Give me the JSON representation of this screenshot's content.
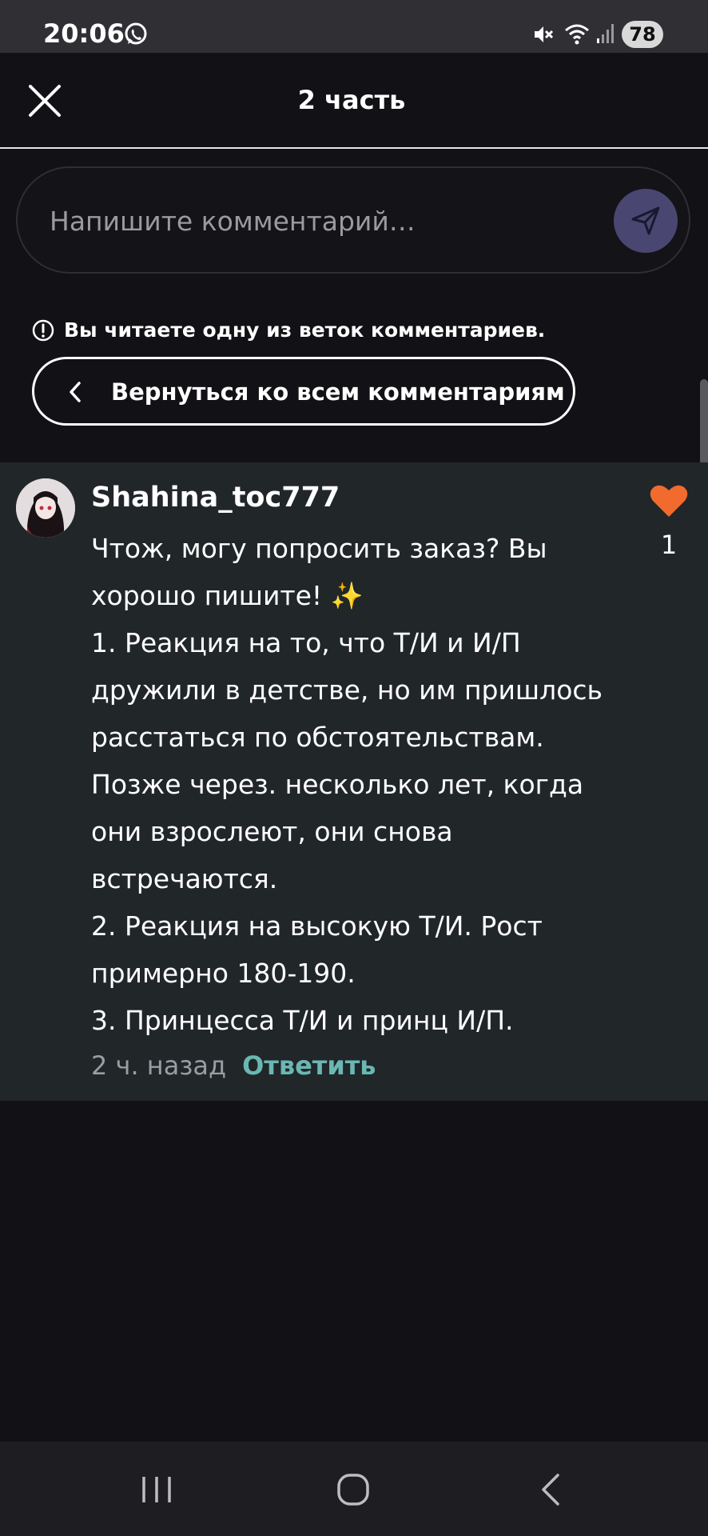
{
  "status_bar": {
    "time": "20:06",
    "battery": "78",
    "icons": [
      "whatsapp-icon",
      "mute-icon",
      "wifi-icon",
      "signal-icon",
      "battery-icon"
    ]
  },
  "header": {
    "title": "2 часть",
    "close_icon": "close-icon"
  },
  "comment_input": {
    "placeholder": "Напишите комментарий…",
    "value": "",
    "send_icon": "send-icon"
  },
  "thread": {
    "info_text": "Вы читаете одну из веток комментариев.",
    "back_label": "Вернуться ко всем комментариям"
  },
  "comment": {
    "author": "Shahina_toc777",
    "lines": [
      "Чтож, могу попросить заказ? Вы",
      "хорошо пишите! ✨",
      "1. Реакция на то, что Т/И и И/П",
      "дружили в детстве, но им пришлось",
      "расстаться по обстоятельствам.",
      "Позже через. несколько лет, когда",
      "они взрослеют, они снова",
      "встречаются.",
      "2. Реакция на высокую Т/И. Рост",
      "примерно 180-190.",
      "3. Принцесса Т/И и принц И/П."
    ],
    "time": "2 ч. назад",
    "reply_label": "Ответить",
    "likes": "1"
  },
  "colors": {
    "background": "#121115",
    "status_bar": "#302f34",
    "card": "#212629",
    "accent_send": "#4a4672",
    "like": "#f26a2e",
    "reply": "#6ab7b3"
  }
}
